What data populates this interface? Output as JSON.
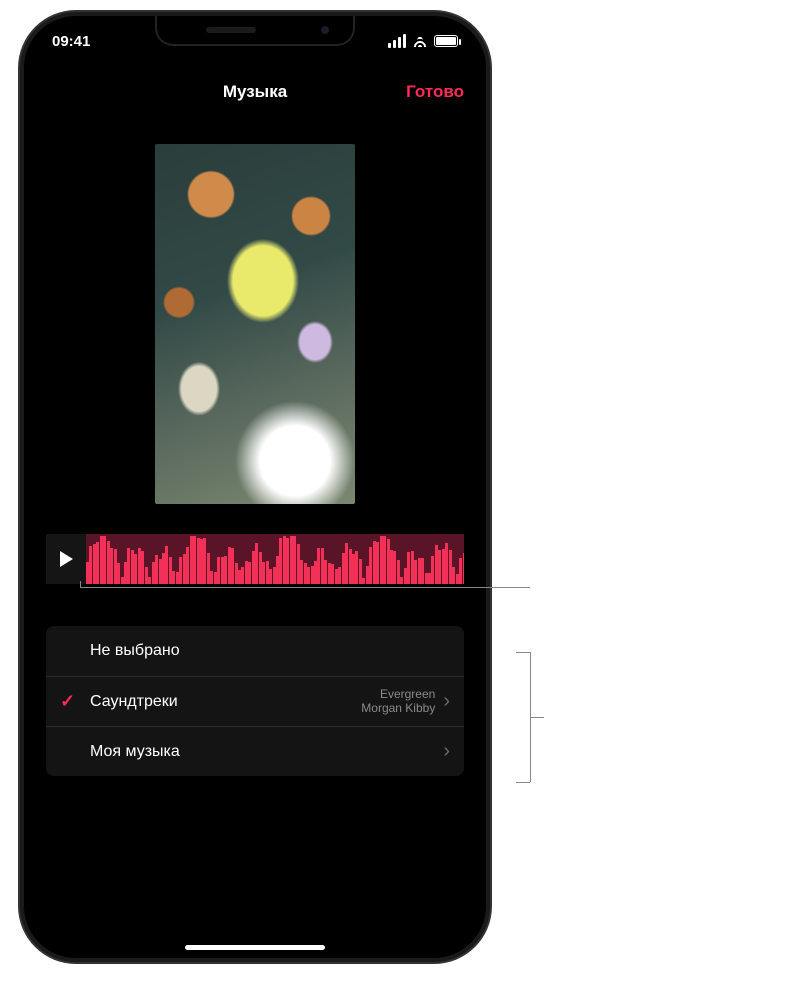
{
  "status": {
    "time": "09:41"
  },
  "nav": {
    "title": "Музыка",
    "done_label": "Готово"
  },
  "accent_color": "#ff2b55",
  "music_options": {
    "none_label": "Не выбрано",
    "soundtracks": {
      "label": "Саундтреки",
      "track_title": "Evergreen",
      "track_artist": "Morgan Kibby",
      "selected": true
    },
    "my_music": {
      "label": "Моя музыка"
    }
  }
}
